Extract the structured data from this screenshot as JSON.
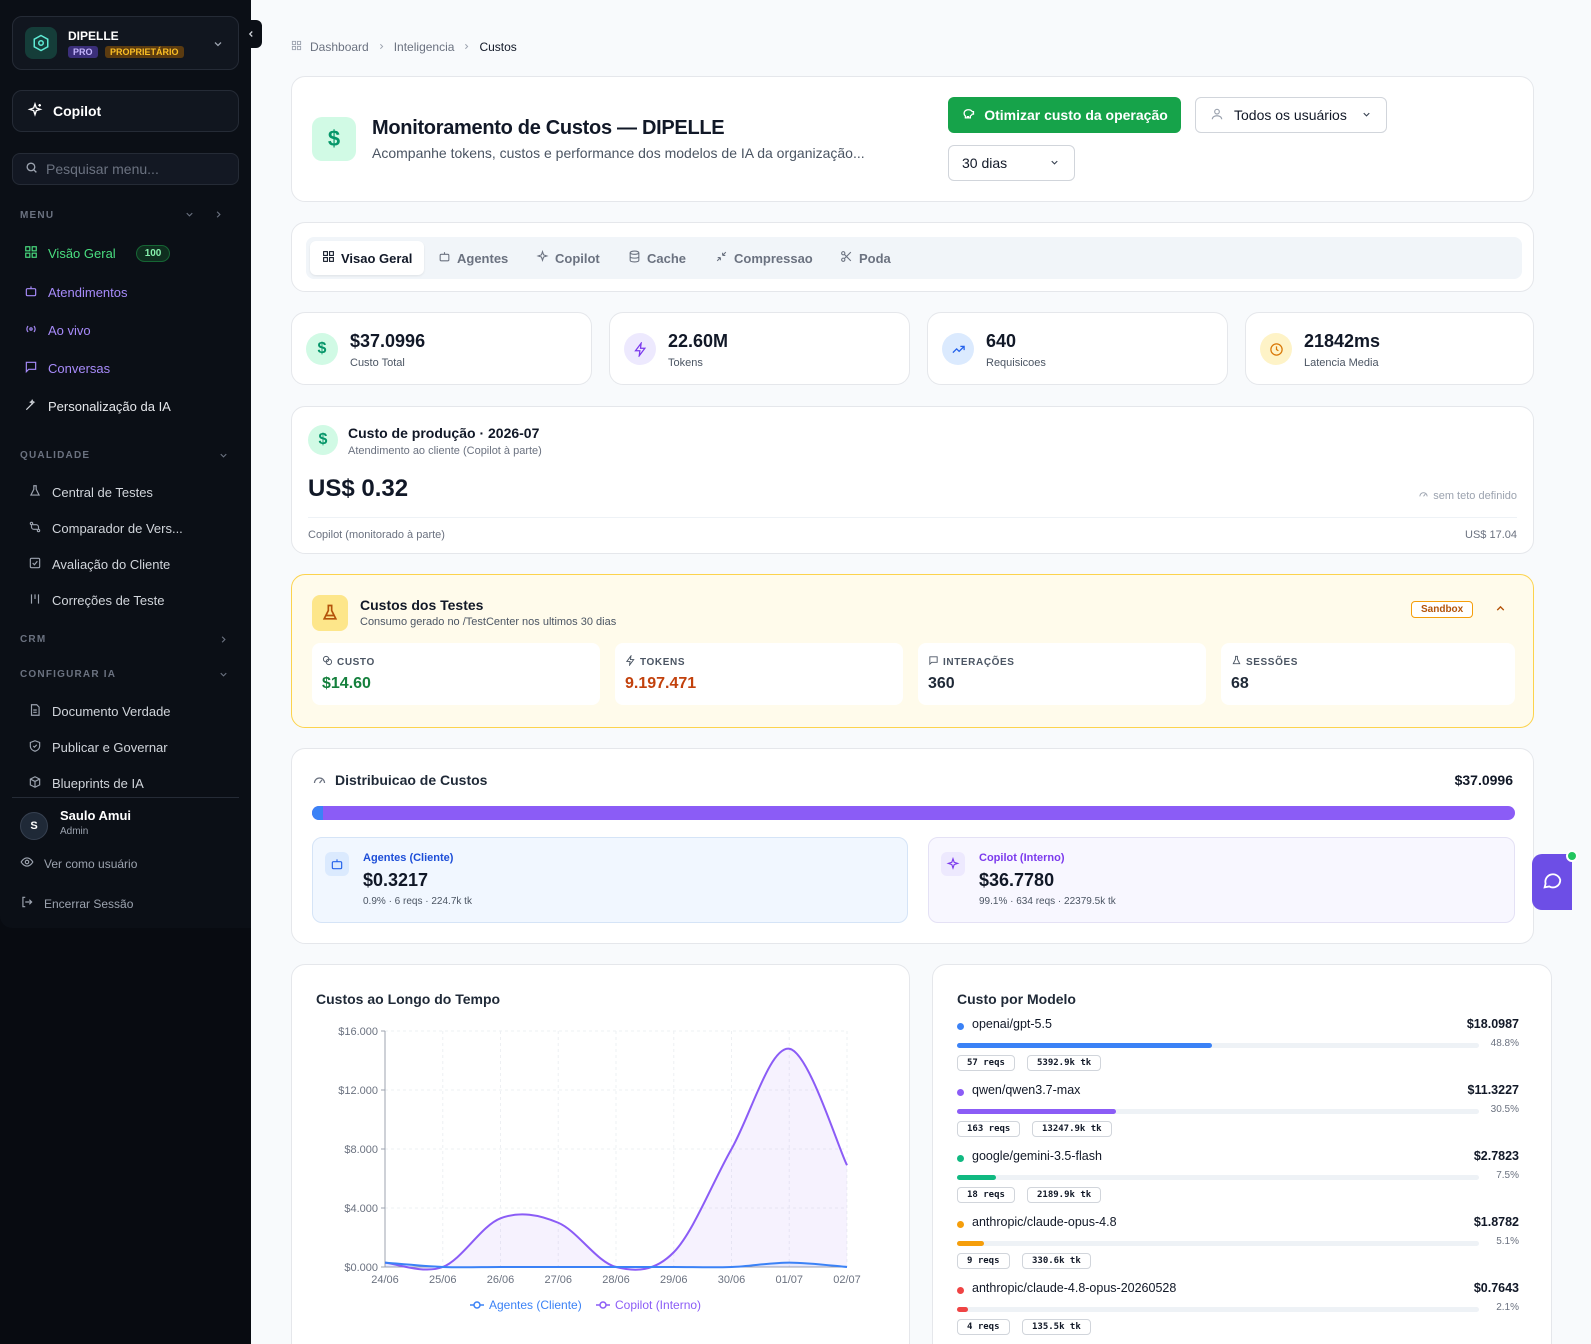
{
  "sidebar": {
    "org_name": "DIPELLE",
    "plan_badge": "PRO",
    "role_badge": "PROPRIETÁRIO",
    "copilot_label": "Copilot",
    "search_placeholder": "Pesquisar menu...",
    "sections": {
      "menu": "MENU",
      "quality": "QUALIDADE",
      "crm": "CRM",
      "configure": "CONFIGURAR IA"
    },
    "menu_items": [
      {
        "label": "Visão Geral",
        "badge": "100"
      },
      {
        "label": "Atendimentos"
      },
      {
        "label": "Ao vivo"
      },
      {
        "label": "Conversas"
      },
      {
        "label": "Personalização da IA"
      }
    ],
    "quality_items": [
      {
        "label": "Central de Testes"
      },
      {
        "label": "Comparador de Vers..."
      },
      {
        "label": "Avaliação do Cliente"
      },
      {
        "label": "Correções de Teste"
      }
    ],
    "configure_items": [
      {
        "label": "Documento Verdade"
      },
      {
        "label": "Publicar e Governar"
      },
      {
        "label": "Blueprints de IA"
      }
    ],
    "user": {
      "initial": "S",
      "name": "Saulo Amui",
      "role": "Admin"
    },
    "view_as": "Ver como usuário",
    "logout": "Encerrar Sessão"
  },
  "breadcrumb": [
    "Dashboard",
    "Inteligencia",
    "Custos"
  ],
  "header": {
    "title": "Monitoramento de Custos — DIPELLE",
    "subtitle": "Acompanhe tokens, custos e performance dos modelos de IA da organização...",
    "optimize_button": "Otimizar custo da operação",
    "users_select": "Todos os usuários",
    "period_select": "30 dias"
  },
  "tabs": [
    "Visao Geral",
    "Agentes",
    "Copilot",
    "Cache",
    "Compressao",
    "Poda"
  ],
  "kpis": [
    {
      "value": "$37.0996",
      "label": "Custo Total"
    },
    {
      "value": "22.60M",
      "label": "Tokens"
    },
    {
      "value": "640",
      "label": "Requisicoes"
    },
    {
      "value": "21842ms",
      "label": "Latencia Media"
    }
  ],
  "production": {
    "title": "Custo de produção · 2026-07",
    "subtitle": "Atendimento ao cliente (Copilot à parte)",
    "value": "US$ 0.32",
    "cap_note": "sem teto definido",
    "copilot_label": "Copilot (monitorado à parte)",
    "copilot_value": "US$ 17.04"
  },
  "tests": {
    "title": "Custos dos Testes",
    "subtitle": "Consumo gerado no /TestCenter nos ultimos 30 dias",
    "badge": "Sandbox",
    "metrics": [
      {
        "label": "CUSTO",
        "value": "$14.60"
      },
      {
        "label": "TOKENS",
        "value": "9.197.471"
      },
      {
        "label": "INTERAÇÕES",
        "value": "360"
      },
      {
        "label": "SESSÕES",
        "value": "68"
      }
    ]
  },
  "distribution": {
    "title": "Distribuicao de Custos",
    "total": "$37.0996",
    "agents_share": 0.009,
    "agents": {
      "label": "Agentes (Cliente)",
      "value": "$0.3217",
      "detail": "0.9% · 6 reqs · 224.7k tk"
    },
    "copilot": {
      "label": "Copilot (Interno)",
      "value": "$36.7780",
      "detail": "99.1% · 634 reqs · 22379.5k tk"
    }
  },
  "chart_data": {
    "type": "area",
    "title": "Custos ao Longo do Tempo",
    "x": [
      "24/06",
      "25/06",
      "26/06",
      "27/06",
      "28/06",
      "29/06",
      "30/06",
      "01/07",
      "02/07"
    ],
    "y_ticks": [
      "$0.000",
      "$4.000",
      "$8.000",
      "$12.000",
      "$16.000"
    ],
    "ylim": [
      0,
      16
    ],
    "series": [
      {
        "name": "Agentes (Cliente)",
        "color": "#3b82f6",
        "values": [
          0.3,
          0.0,
          0.0,
          0.0,
          0.0,
          0.0,
          0.0,
          0.3,
          0.0
        ]
      },
      {
        "name": "Copilot (Interno)",
        "color": "#8b5cf6",
        "values": [
          0.3,
          0.0,
          3.3,
          3.0,
          0.0,
          1.0,
          8.0,
          14.8,
          6.9
        ]
      }
    ]
  },
  "models": {
    "title": "Custo por Modelo",
    "items": [
      {
        "name": "openai/gpt-5.5",
        "cost": "$18.0987",
        "pct": "48.8%",
        "share": 0.488,
        "reqs": "57 reqs",
        "tokens": "5392.9k tk",
        "color": "#3b82f6"
      },
      {
        "name": "qwen/qwen3.7-max",
        "cost": "$11.3227",
        "pct": "30.5%",
        "share": 0.305,
        "reqs": "163 reqs",
        "tokens": "13247.9k tk",
        "color": "#8b5cf6"
      },
      {
        "name": "google/gemini-3.5-flash",
        "cost": "$2.7823",
        "pct": "7.5%",
        "share": 0.075,
        "reqs": "18 reqs",
        "tokens": "2189.9k tk",
        "color": "#10b981"
      },
      {
        "name": "anthropic/claude-opus-4.8",
        "cost": "$1.8782",
        "pct": "5.1%",
        "share": 0.051,
        "reqs": "9 reqs",
        "tokens": "330.6k tk",
        "color": "#f59e0b"
      },
      {
        "name": "anthropic/claude-4.8-opus-20260528",
        "cost": "$0.7643",
        "pct": "2.1%",
        "share": 0.021,
        "reqs": "4 reqs",
        "tokens": "135.5k tk",
        "color": "#ef4444"
      }
    ]
  }
}
